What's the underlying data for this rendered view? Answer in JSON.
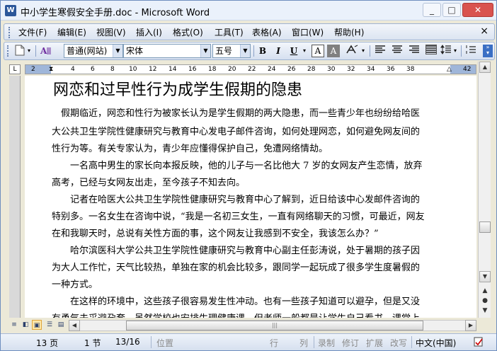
{
  "window": {
    "app_icon": "W",
    "title": "中小学生寒假安全手册.doc - Microsoft Word",
    "minimize": "_",
    "maximize": "□",
    "close": "✕"
  },
  "menu": {
    "items": [
      "文件(F)",
      "编辑(E)",
      "视图(V)",
      "插入(I)",
      "格式(O)",
      "工具(T)",
      "表格(A)",
      "窗口(W)",
      "帮助(H)"
    ],
    "close": "×"
  },
  "toolbar": {
    "style_value": "普通(网站)",
    "font_value": "宋体",
    "size_value": "五号",
    "bold": "B",
    "italic": "I",
    "underline": "U",
    "highlight": "A",
    "font_color": "A"
  },
  "ruler": {
    "tab_selector": "L",
    "numbers": [
      "2",
      "2",
      "4",
      "6",
      "8",
      "10",
      "12",
      "14",
      "16",
      "18",
      "20",
      "22",
      "24",
      "26",
      "28",
      "30",
      "32",
      "34",
      "36",
      "38",
      "42"
    ]
  },
  "document": {
    "title": "网恋和过早性行为成学生假期的隐患",
    "lines": [
      "　假期临近，网恋和性行为被家长认为是学生假期的两大隐患，而一些青少年也纷纷给哈医",
      "大公共卫生学院性健康研究与教育中心发电子邮件咨询，如何处理网恋，如何避免网友间的",
      "性行为等。有关专家认为，青少年应懂得保护自己，免遭网络情劫。",
      "　　一名高中男生的家长向本报反映，他的儿子与一名比他大 7 岁的女网友产生恋情，放弃",
      "高考，已经与女网友出走，至今孩子不知去向。",
      "　　记者在哈医大公共卫生学院性健康研究与教育中心了解到，近日给该中心发邮件咨询的",
      "特别多。一名女生在咨询中说，“我是一名初三女生，一直有网络聊天的习惯，可最近，网友",
      "在和我聊天时，总说有关性方面的事，这个网友让我感到不安全，我该怎么办？”",
      "　　哈尔滨医科大学公共卫生学院性健康研究与教育中心副主任彭涛说，处于暑期的孩子因",
      "为大人工作忙，天气比较热，单独在家的机会比较多，跟同学一起玩成了很多学生度暑假的",
      "一种方式。",
      "　　在这样的环境中，这些孩子很容易发生性冲动。也有一些孩子知道可以避孕，但是又没",
      "有勇气去采避孕套。虽然学校也安排生理健康课，但老师一般都是让学生自己看书，课堂上"
    ]
  },
  "statusbar": {
    "page": "13 页",
    "section": "1 节",
    "page_of": "13/16",
    "position": "位置",
    "line": "行",
    "column": "列",
    "rec": "录制",
    "trk": "修订",
    "ext": "扩展",
    "ovr": "改写",
    "language": "中文(中国)"
  }
}
